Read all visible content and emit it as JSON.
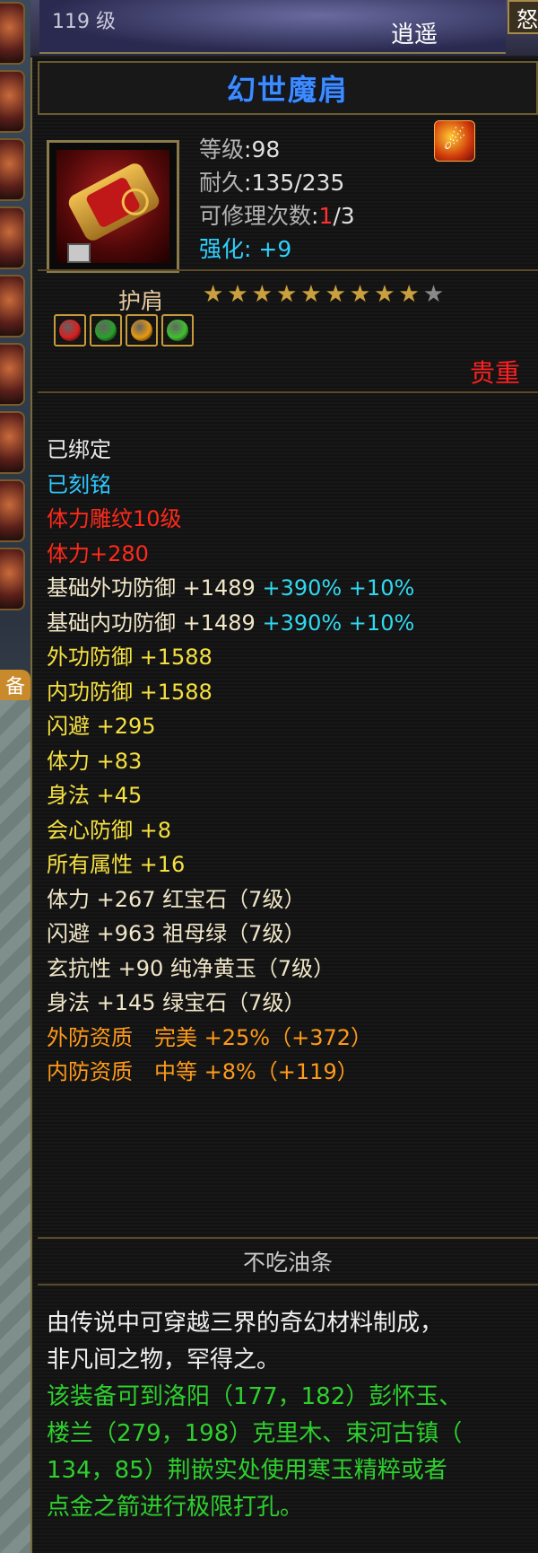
{
  "topbar": {
    "level": "119 级",
    "nickname": "逍遥",
    "rage": "怒"
  },
  "left_tab": "备",
  "item": {
    "name": "幻世魔肩",
    "level_label": "等级",
    "level_value": ":98",
    "durability_label": "耐久",
    "durability_value": ":135/235",
    "repair_label": "可修理次数",
    "repair_used": "1",
    "repair_total": "/3",
    "enhance_label": "强化",
    "enhance_value": ": +9",
    "type": "护肩",
    "stars_lit": 9,
    "stars_total": 10,
    "rarity": "贵重",
    "gem_colors": [
      "#d82020",
      "#2aa02a",
      "#e89a10",
      "#40c030"
    ]
  },
  "attributes": {
    "bound": "已绑定",
    "engraved": "已刻铭",
    "carving": "体力雕纹10级",
    "carving_bonus": "体力+280",
    "base_outer_def": "基础外功防御 +1489",
    "base_outer_def_pct": " +390% +10%",
    "base_inner_def": "基础内功防御 +1489",
    "base_inner_def_pct": " +390% +10%",
    "outer_def": "外功防御 +1588",
    "inner_def": "内功防御 +1588",
    "dodge": "闪避 +295",
    "stamina": "体力 +83",
    "agility": "身法 +45",
    "crit_def": "会心防御 +8",
    "all_attr": "所有属性 +16",
    "gem1": "体力 +267 红宝石（7级）",
    "gem2": "闪避 +963 祖母绿（7级）",
    "gem3": "玄抗性 +90 纯净黄玉（7级）",
    "gem4": "身法 +145 绿宝石（7级）",
    "quality_outer": "外防资质　完美 +25%（+372）",
    "quality_inner": "内防资质　中等 +8%（+119）"
  },
  "owner": "不吃油条",
  "description": {
    "line1": "由传说中可穿越三界的奇幻材料制成，",
    "line2": "非凡间之物，罕得之。",
    "line3": "该装备可到洛阳（177，182）彭怀玉、",
    "line4": "楼兰（279，198）克里木、束河古镇（",
    "line5": "134，85）荆嵌实处使用寒玉精粹或者",
    "line6": "点金之箭进行极限打孔。"
  }
}
